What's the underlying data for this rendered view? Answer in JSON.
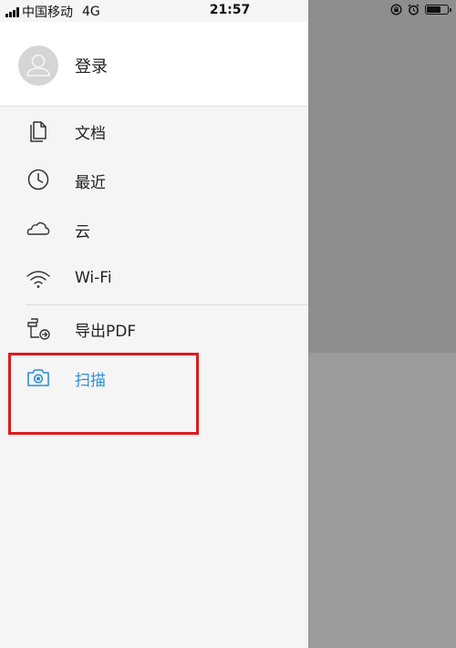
{
  "status_bar": {
    "carrier": "中国移动",
    "network": "4G",
    "time": "21:57",
    "icons": [
      "orientation-lock-icon",
      "alarm-icon",
      "battery-icon"
    ]
  },
  "drawer": {
    "login_label": "登录",
    "menu": [
      {
        "label": "文档",
        "icon": "document-icon"
      },
      {
        "label": "最近",
        "icon": "clock-icon"
      },
      {
        "label": "云",
        "icon": "cloud-icon"
      },
      {
        "label": "Wi-Fi",
        "icon": "wifi-icon"
      },
      {
        "label": "导出PDF",
        "icon": "export-pdf-icon"
      },
      {
        "label": "扫描",
        "icon": "camera-icon",
        "active": true
      }
    ],
    "active_color": "#2f8fd5"
  },
  "annotation_color": "#e0191b"
}
